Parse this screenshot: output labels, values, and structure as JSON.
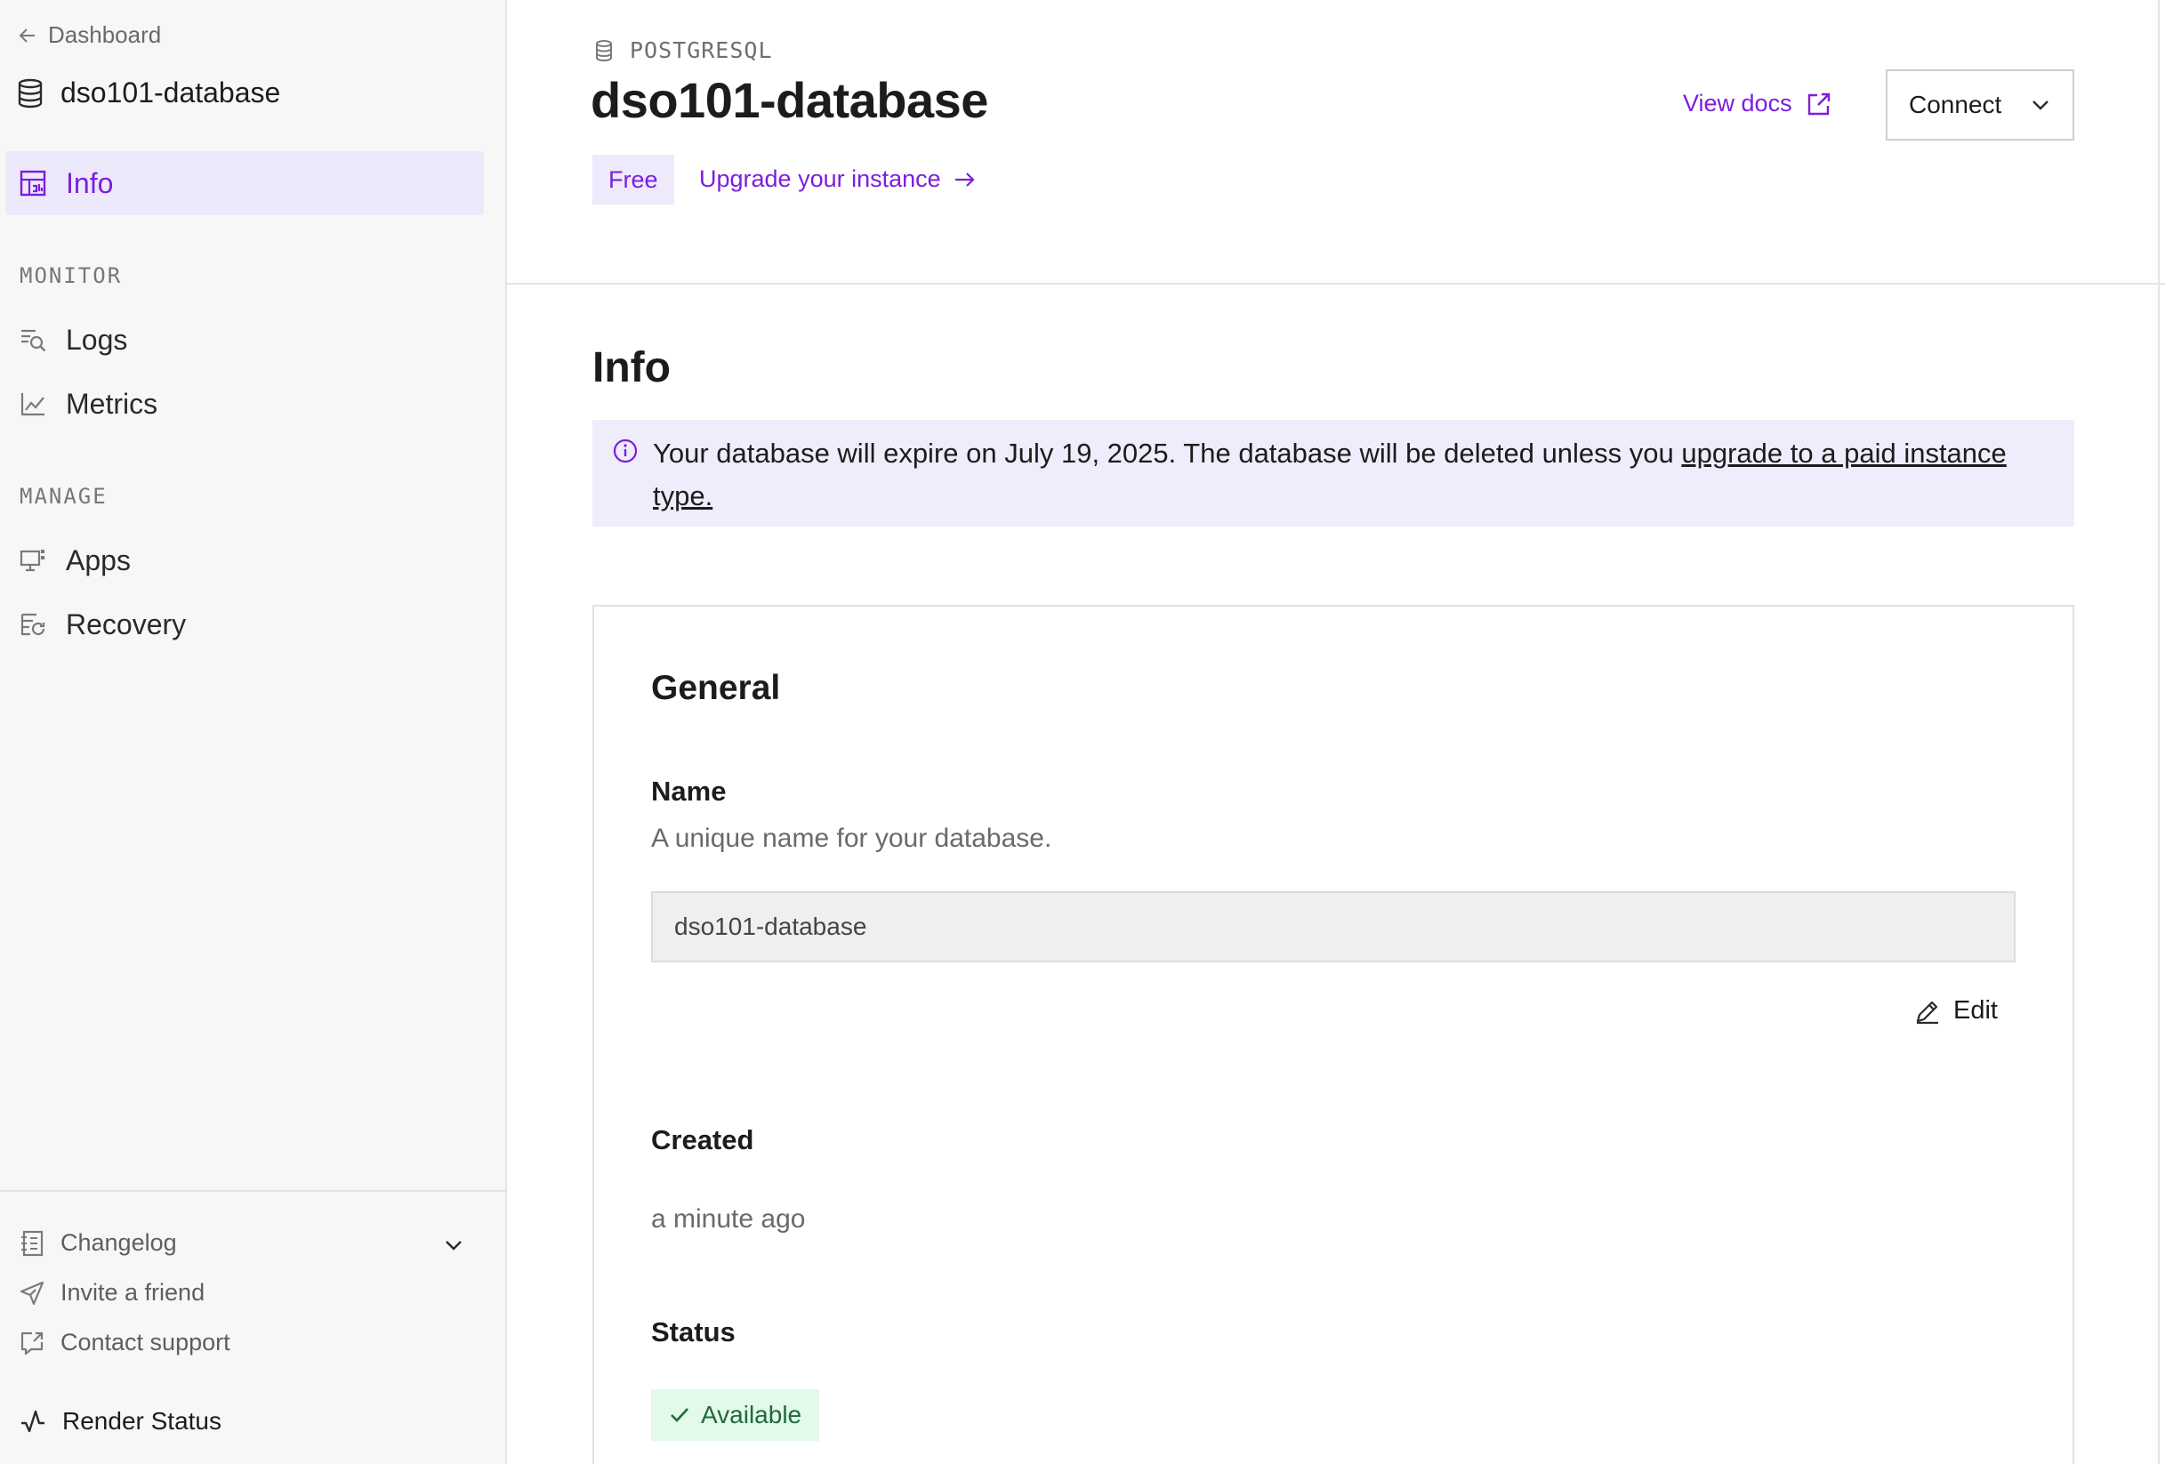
{
  "sidebar": {
    "back_label": "Dashboard",
    "db_name": "dso101-database",
    "nav_info": "Info",
    "section_monitor": "MONITOR",
    "nav_logs": "Logs",
    "nav_metrics": "Metrics",
    "section_manage": "MANAGE",
    "nav_apps": "Apps",
    "nav_recovery": "Recovery",
    "footer_changelog": "Changelog",
    "footer_invite": "Invite a friend",
    "footer_support": "Contact support",
    "footer_status": "Render Status"
  },
  "header": {
    "type_label": "POSTGRESQL",
    "title": "dso101-database",
    "plan_badge": "Free",
    "upgrade_label": "Upgrade your instance",
    "view_docs_label": "View docs",
    "connect_label": "Connect"
  },
  "main": {
    "section_title": "Info",
    "alert_text": "Your database will expire on July 19, 2025. The database will be deleted unless you ",
    "alert_link": "upgrade to a paid instance type.",
    "general_title": "General",
    "name_label": "Name",
    "name_desc": "A unique name for your database.",
    "name_value": "dso101-database",
    "edit_label": "Edit",
    "created_label": "Created",
    "created_value": "a minute ago",
    "status_label": "Status",
    "status_value": "Available"
  },
  "colors": {
    "accent": "#7b1ede",
    "accent_bg": "#ece9fb",
    "success_bg": "#e3f9ea",
    "success_text": "#1e6b3a"
  },
  "icons": {
    "back": "arrow-left-icon",
    "database": "database-icon",
    "info": "dashboard-icon",
    "logs": "log-search-icon",
    "metrics": "chart-line-icon",
    "apps": "monitor-icon",
    "recovery": "recovery-icon",
    "changelog": "notebook-icon",
    "invite": "send-icon",
    "support": "external-chat-icon",
    "status": "activity-icon",
    "external": "external-link-icon",
    "alert": "info-circle-icon",
    "edit": "pencil-icon",
    "check": "check-icon"
  }
}
